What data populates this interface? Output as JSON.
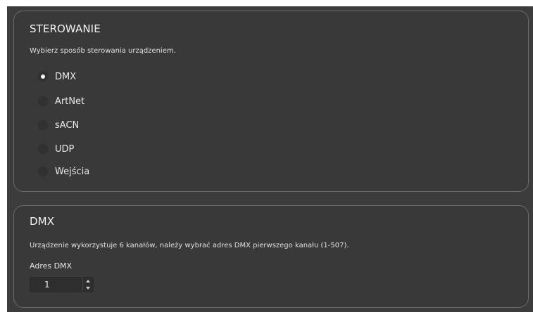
{
  "control": {
    "title": "STEROWANIE",
    "description": "Wybierz sposób sterowania urządzeniem.",
    "options": [
      {
        "label": "DMX",
        "checked": true
      },
      {
        "label": "ArtNet",
        "checked": false
      },
      {
        "label": "sACN",
        "checked": false
      },
      {
        "label": "UDP",
        "checked": false
      },
      {
        "label": "Wejścia",
        "checked": false
      }
    ]
  },
  "dmx": {
    "title": "DMX",
    "description": "Urządzenie wykorzystuje 6 kanałów, należy wybrać adres DMX pierwszego kanału (1-507).",
    "address_label": "Adres DMX",
    "address_value": "1"
  },
  "colors": {
    "background": "#3c3c3c",
    "panel": "#393939",
    "panel_border": "#6a6a6a",
    "text": "#e6e6e6"
  }
}
